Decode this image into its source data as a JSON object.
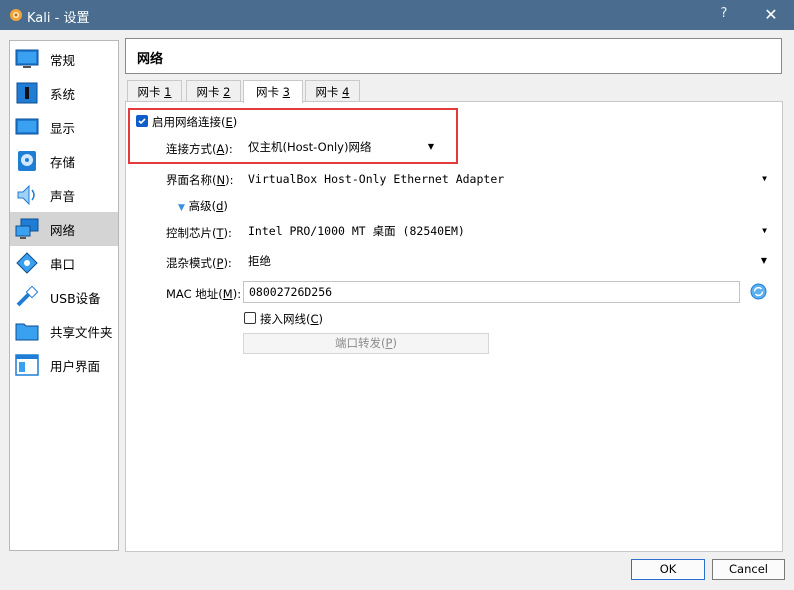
{
  "window": {
    "title": "Kali - 设置",
    "help_label": "?",
    "close_label": "✕"
  },
  "sidebar": {
    "items": [
      {
        "label": "常规",
        "icon": "general-icon"
      },
      {
        "label": "系统",
        "icon": "system-icon"
      },
      {
        "label": "显示",
        "icon": "display-icon"
      },
      {
        "label": "存储",
        "icon": "storage-icon"
      },
      {
        "label": "声音",
        "icon": "audio-icon"
      },
      {
        "label": "网络",
        "icon": "network-icon",
        "selected": true
      },
      {
        "label": "串口",
        "icon": "serial-port-icon"
      },
      {
        "label": "USB设备",
        "icon": "usb-icon"
      },
      {
        "label": "共享文件夹",
        "icon": "shared-folder-icon"
      },
      {
        "label": "用户界面",
        "icon": "user-interface-icon"
      }
    ]
  },
  "page_title": "网络",
  "tabs": [
    {
      "text": "网卡 ",
      "key": "1"
    },
    {
      "text": "网卡 ",
      "key": "2"
    },
    {
      "text": "网卡 ",
      "key": "3",
      "active": true
    },
    {
      "text": "网卡 ",
      "key": "4"
    }
  ],
  "adapter": {
    "enable": {
      "text": "启用网络连接(",
      "key": "E",
      "close": ")",
      "checked": true
    },
    "attached": {
      "text": "连接方式(",
      "key": "A",
      "close": "):",
      "value": "仅主机(Host-Only)网络"
    },
    "name": {
      "text": "界面名称(",
      "key": "N",
      "close": "):",
      "value": "VirtualBox Host-Only Ethernet Adapter"
    },
    "advanced": {
      "text": "高级(",
      "key": "d",
      "close": ")"
    },
    "chip": {
      "text": "控制芯片(",
      "key": "T",
      "close": "):",
      "value": "Intel PRO/1000 MT 桌面 (82540EM)"
    },
    "promisc": {
      "text": "混杂模式(",
      "key": "P",
      "close": "):",
      "value": "拒绝"
    },
    "mac": {
      "text": "MAC 地址(",
      "key": "M",
      "close": "):",
      "value": "08002726D256"
    },
    "cable": {
      "text": "接入网线(",
      "key": "C",
      "close": ")",
      "checked": false
    },
    "port_forward": {
      "text": "端口转发(",
      "key": "P",
      "close": ")"
    }
  },
  "buttons": {
    "ok": "OK",
    "cancel": "Cancel"
  },
  "colors": {
    "titlebar": "#4a6c8e",
    "highlight_border": "#e33b3b",
    "checkbox": "#0f5ccc"
  }
}
